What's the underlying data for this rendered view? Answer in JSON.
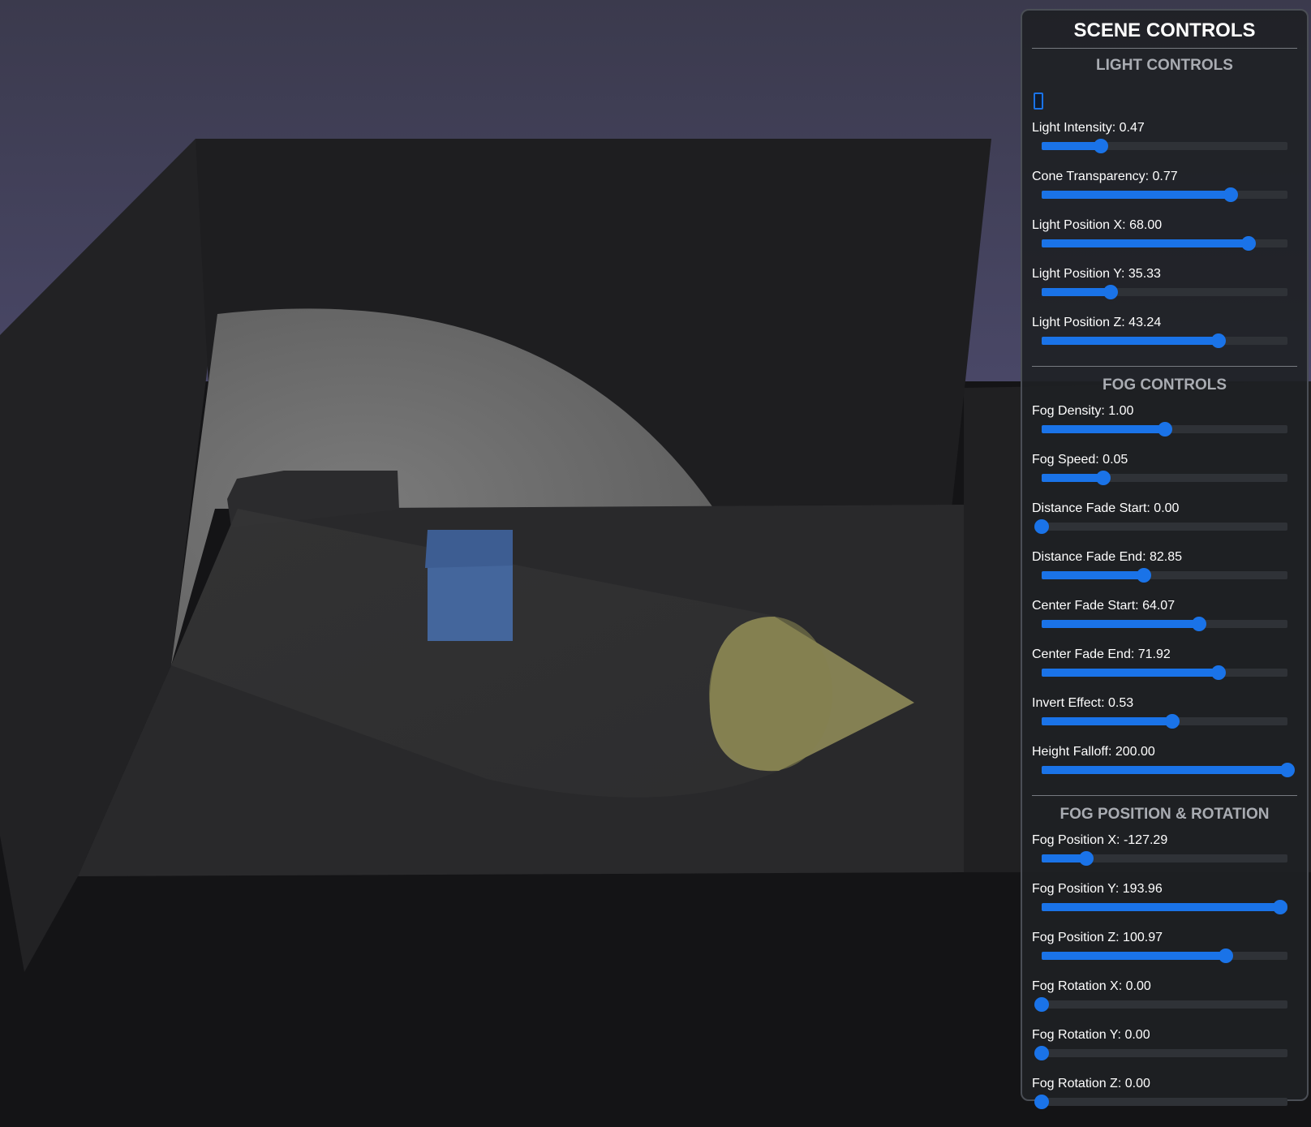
{
  "colors": {
    "accent": "#1a73e8",
    "sky": "#3f3d58",
    "wall": "#1f1f21",
    "floor": "#262628",
    "cube": "#44669c",
    "cone": "#8e8a58",
    "panel_bg": "#1e2024"
  },
  "panel": {
    "title": "SCENE CONTROLS",
    "sections": [
      {
        "title": "LIGHT CONTROLS",
        "has_toggle": true,
        "sliders": [
          {
            "label": "Light Intensity: 0.47",
            "fraction": 0.24
          },
          {
            "label": "Cone Transparency: 0.77",
            "fraction": 0.77
          },
          {
            "label": "Light Position X: 68.00",
            "fraction": 0.84
          },
          {
            "label": "Light Position Y: 35.33",
            "fraction": 0.28
          },
          {
            "label": "Light Position Z: 43.24",
            "fraction": 0.72
          }
        ]
      },
      {
        "title": "FOG CONTROLS",
        "has_toggle": false,
        "sliders": [
          {
            "label": "Fog Density: 1.00",
            "fraction": 0.5
          },
          {
            "label": "Fog Speed: 0.05",
            "fraction": 0.25
          },
          {
            "label": "Distance Fade Start: 0.00",
            "fraction": 0.0
          },
          {
            "label": "Distance Fade End: 82.85",
            "fraction": 0.415
          },
          {
            "label": "Center Fade Start: 64.07",
            "fraction": 0.64
          },
          {
            "label": "Center Fade End: 71.92",
            "fraction": 0.72
          },
          {
            "label": "Invert Effect: 0.53",
            "fraction": 0.53
          },
          {
            "label": "Height Falloff: 200.00",
            "fraction": 1.0
          }
        ]
      },
      {
        "title": "FOG POSITION & ROTATION",
        "has_toggle": false,
        "sliders": [
          {
            "label": "Fog Position X: -127.29",
            "fraction": 0.18
          },
          {
            "label": "Fog Position Y: 193.96",
            "fraction": 0.97
          },
          {
            "label": "Fog Position Z: 100.97",
            "fraction": 0.75
          },
          {
            "label": "Fog Rotation X: 0.00",
            "fraction": 0.0
          },
          {
            "label": "Fog Rotation Y: 0.00",
            "fraction": 0.0
          },
          {
            "label": "Fog Rotation Z: 0.00",
            "fraction": 0.0
          }
        ]
      }
    ]
  }
}
